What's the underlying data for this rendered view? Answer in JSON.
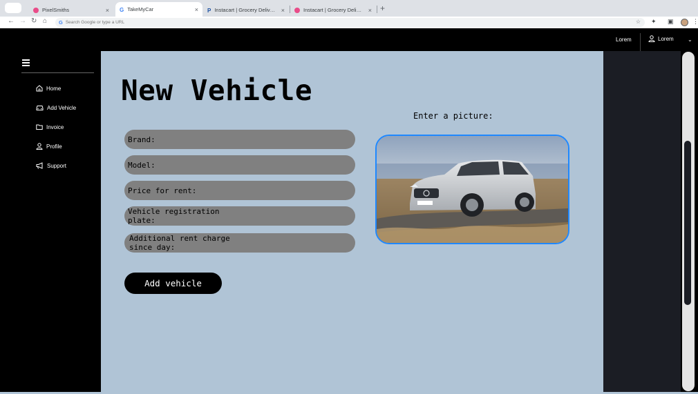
{
  "browser": {
    "tabs": [
      {
        "title": "PixelSmiths",
        "favicon": "dribbble-icon",
        "active": false
      },
      {
        "title": "TakeMyCar",
        "favicon": "google-icon",
        "active": true
      },
      {
        "title": "Instacart | Grocery Delivery or...",
        "favicon": "paypal-icon",
        "active": false
      },
      {
        "title": "Instacart | Grocery Delivery or...",
        "favicon": "dribbble-icon",
        "active": false
      }
    ],
    "new_tab": "+",
    "omnibox_placeholder": "Search Google or type a URL"
  },
  "header": {
    "link": "Lorem",
    "user": "Lorem"
  },
  "sidebar": {
    "items": [
      {
        "label": "Home",
        "icon": "home-icon"
      },
      {
        "label": "Add Vehicle",
        "icon": "car-icon"
      },
      {
        "label": "Invoice",
        "icon": "folder-icon"
      },
      {
        "label": "Profile",
        "icon": "user-icon"
      },
      {
        "label": "Support",
        "icon": "megaphone-icon"
      }
    ]
  },
  "form": {
    "title": "New Vehicle",
    "fields": [
      {
        "label": "Brand:",
        "value": ""
      },
      {
        "label": "Model:",
        "value": ""
      },
      {
        "label": "Price for rent:",
        "value": ""
      },
      {
        "label": "Vehicle registration plate:",
        "value": ""
      },
      {
        "label": "Additional rent charge since day:",
        "value": ""
      }
    ],
    "submit_label": "Add vehicle",
    "picture_label": "Enter a picture:"
  },
  "colors": {
    "main_bg": "#b0c4d6",
    "field_bg": "#808080",
    "picture_border": "#1e88ff"
  }
}
